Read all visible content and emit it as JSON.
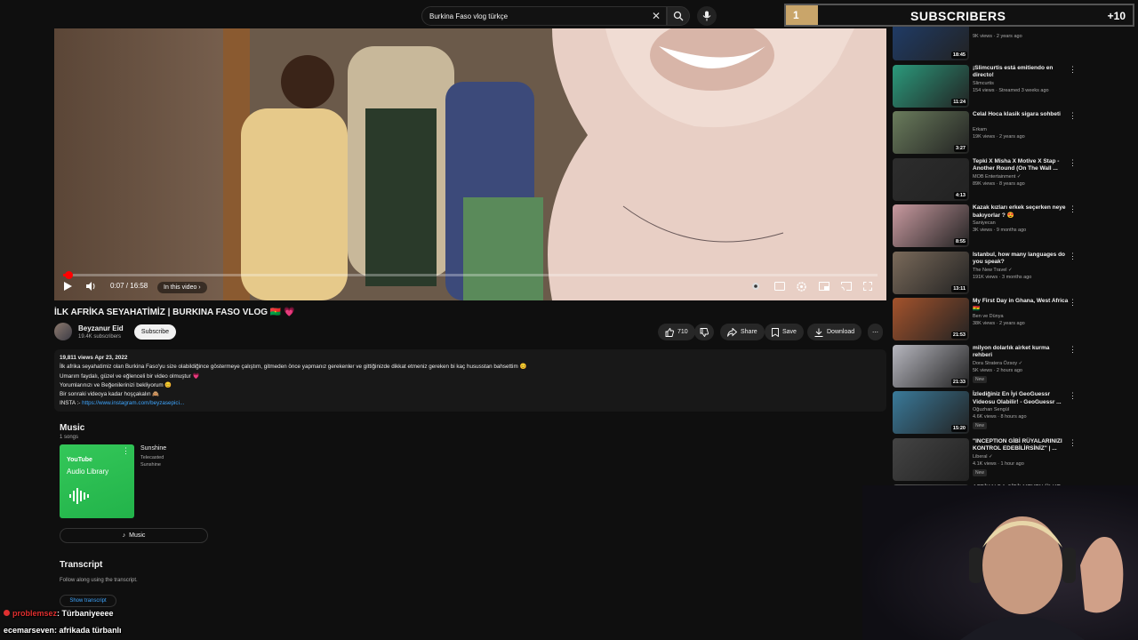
{
  "search": {
    "query": "Burkina Faso vlog türkçe"
  },
  "overlay": {
    "count": "1",
    "label": "SUBSCRIBERS",
    "plus": "+10"
  },
  "player": {
    "time": "0:07 / 16:58",
    "in_this_video": "In this video",
    "progress": 0.007
  },
  "video": {
    "title": "İLK AFRİKA SEYAHATİMİZ | BURKINA FASO VLOG 🇧🇫 💗",
    "channel": "Beyzanur Eid",
    "subs": "19.4K subscribers",
    "subscribe": "Subscribe",
    "likes": "710",
    "share": "Share",
    "save": "Save",
    "download": "Download"
  },
  "description": {
    "meta": "19,811 views  Apr 23, 2022",
    "lines": [
      "İlk afrika seyahatimiz olan Burkina Faso'yu size olabildiğince göstermeye çalıştım, gitmeden önce yapmanız gerekenler ve gittiğinizde dikkat etmeniz gereken bi kaç hususstan bahsettim 😊",
      "Umarım faydalı, güzel ve eğlenceli bir video olmuştur 💗",
      "Yorumlarınızı ve Beğenilerinizi bekliyorum 😊",
      "Bir sonraki videoya kadar hoşçakalın 🙈"
    ],
    "insta_label": "INSTA :-",
    "insta_link": "https://www.instagram.com/beyzasepici..."
  },
  "music": {
    "title": "Music",
    "count": "1 songs",
    "badge": "YouTube",
    "library": "Audio Library",
    "song": "Sunshine",
    "artist": "Telecasted",
    "album": "Sunshine",
    "button": "Music"
  },
  "transcript": {
    "title": "Transcript",
    "subtitle": "Follow along using the transcript.",
    "button": "Show transcript"
  },
  "sidebar": [
    {
      "title": "",
      "channel": "",
      "meta": "9K views · 2 years ago",
      "duration": "18:45",
      "color": "#1f3d6b",
      "new": ""
    },
    {
      "title": "¡Slimcurtis está emitiendo en directo!",
      "channel": "Slimcurtis",
      "meta": "154 views · Streamed 3 weeks ago",
      "duration": "11:24",
      "color": "#2b9a7c",
      "new": ""
    },
    {
      "title": "Celal Hoca klasik sigara sohbeti",
      "channel": "Erkam",
      "meta": "19K views · 2 years ago",
      "duration": "3:27",
      "color": "#6a7c5c",
      "new": ""
    },
    {
      "title": "Tepki X Misha X Motive X Stap - Another Round (On The Wall ...",
      "channel": "MOB Entertainment ✓",
      "meta": "89K views · 8 years ago",
      "duration": "4:13",
      "color": "#2d2d2d",
      "new": ""
    },
    {
      "title": "Kazak kızları erkek seçerken neye bakıyorlar ? 😍",
      "channel": "Saniyecan",
      "meta": "3K views · 9 months ago",
      "duration": "8:55",
      "color": "#c99aa0",
      "new": ""
    },
    {
      "title": "Istanbul, how many languages do you speak?",
      "channel": "The New Travel ✓",
      "meta": "191K views · 3 months ago",
      "duration": "13:11",
      "color": "#7a6a5a",
      "new": ""
    },
    {
      "title": "My First Day in Ghana, West Africa 🇬🇭",
      "channel": "Ben ve Dünya",
      "meta": "38K views · 2 years ago",
      "duration": "21:53",
      "color": "#a4532c",
      "new": ""
    },
    {
      "title": "milyon dolarlık airket kurma rehberi",
      "channel": "Dora Stratera Özsoy ✓",
      "meta": "5K views · 2 hours ago",
      "duration": "21:33",
      "color": "#b7b7bf",
      "new": "New"
    },
    {
      "title": "İzlediğiniz En İyi GeoGuessr Videosu Olabilir! - GeoGuessr ...",
      "channel": "Oğuzhan Sengül",
      "meta": "4.6K views · 8 hours ago",
      "duration": "15:20",
      "color": "#3a7a9a",
      "new": "New"
    },
    {
      "title": "\"INCEPTION GİBİ RÜYALARINIZI KONTROL EDEBİLİRSİNİZ\" | ...",
      "channel": "Liberal ✓",
      "meta": "4.1K views · 1 hour ago",
      "duration": "",
      "color": "#444444",
      "new": "New"
    },
    {
      "title": "AFRİKA' DA GİDİLMEYEN ÜLKE BURKİNA FASO ! VACABUSU",
      "channel": "",
      "meta": "",
      "duration": "",
      "color": "#5a5a5a",
      "new": ""
    }
  ],
  "chat": [
    {
      "name": "problemsez",
      "message": ": Türbaniyeeee"
    },
    {
      "name": "ecemarseven",
      "message": ": afrikada türbanlı"
    }
  ],
  "colors": {
    "accent": "#ff0000",
    "link": "#3ea6ff",
    "album": "#22b34a",
    "overlay_gold": "#c9a56a"
  }
}
